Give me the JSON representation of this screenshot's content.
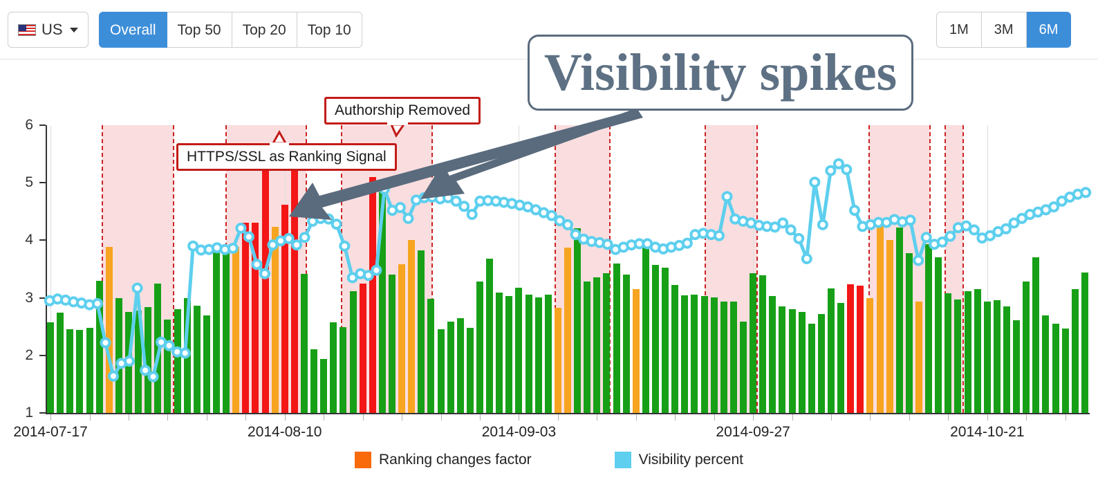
{
  "toolbar": {
    "country": {
      "label": "US",
      "flag_icon": "us-flag-icon",
      "caret_icon": "chevron-down-icon"
    },
    "views": [
      {
        "label": "Overall",
        "active": true
      },
      {
        "label": "Top 50",
        "active": false
      },
      {
        "label": "Top 20",
        "active": false
      },
      {
        "label": "Top 10",
        "active": false
      }
    ],
    "ranges": [
      {
        "label": "1M",
        "active": false
      },
      {
        "label": "3M",
        "active": false
      },
      {
        "label": "6M",
        "active": true
      }
    ]
  },
  "annotations": {
    "authorship": "Authorship Removed",
    "https": "HTTPS/SSL as Ranking Signal",
    "spikes": "Visibility spikes"
  },
  "legend": [
    {
      "label": "Ranking changes factor",
      "color": "#f96a0b"
    },
    {
      "label": "Visibility percent",
      "color": "#5ecfee"
    }
  ],
  "colors": {
    "bar_normal": "#17a017",
    "bar_warn": "#f7a420",
    "bar_alert": "#f21616",
    "line": "#5ecfee",
    "marker_fill": "#ffffff",
    "band": "#fadedf",
    "band_edge": "#cc2222",
    "accent_blue": "#3d8ed8",
    "callout_border": "#c21b17",
    "spike_text": "#5e7184"
  },
  "chart_data": {
    "type": "bar",
    "title": "",
    "xlabel": "",
    "ylabel": "",
    "ylim": [
      1,
      6
    ],
    "yticks": [
      1,
      2,
      3,
      4,
      5,
      6
    ],
    "grid": true,
    "legend_position": "bottom",
    "xtick_labels": [
      "2014-07-17",
      "2014-08-10",
      "2014-09-03",
      "2014-09-27",
      "2014-10-21"
    ],
    "xtick_index": [
      0,
      24,
      48,
      72,
      96
    ],
    "series": [
      {
        "name": "Ranking changes factor",
        "type": "bar",
        "values": [
          2.57,
          2.74,
          2.46,
          2.44,
          2.48,
          3.3,
          3.88,
          2.99,
          2.76,
          2.78,
          2.84,
          3.25,
          2.62,
          2.8,
          3.0,
          2.86,
          2.7,
          3.85,
          3.78,
          3.88,
          4.3,
          4.3,
          5.42,
          4.23,
          4.62,
          5.45,
          3.42,
          2.11,
          1.94,
          2.57,
          2.49,
          3.12,
          3.25,
          5.1,
          4.87,
          3.4,
          3.58,
          4.01,
          3.82,
          2.98,
          2.45,
          2.59,
          2.65,
          2.48,
          3.28,
          3.68,
          3.09,
          3.03,
          3.18,
          3.05,
          3.01,
          3.05,
          2.83,
          3.87,
          4.21,
          3.28,
          3.35,
          3.43,
          3.6,
          3.41,
          3.15,
          3.88,
          3.57,
          3.53,
          3.22,
          3.04,
          3.06,
          3.03,
          3.01,
          2.94,
          2.93,
          2.59,
          3.43,
          3.39,
          3.03,
          2.85,
          2.8,
          2.76,
          2.55,
          2.72,
          3.16,
          2.91,
          3.23,
          3.21,
          2.99,
          4.38,
          4.0,
          4.22,
          3.78,
          2.94,
          3.93,
          3.7,
          3.08,
          2.97,
          3.12,
          3.15,
          2.94,
          2.96,
          2.85,
          2.61,
          3.28,
          3.71,
          2.7,
          2.55,
          2.47,
          3.15,
          3.44
        ],
        "categories": [
          "normal",
          "normal",
          "normal",
          "normal",
          "normal",
          "normal",
          "warn",
          "normal",
          "normal",
          "normal",
          "normal",
          "normal",
          "normal",
          "normal",
          "normal",
          "normal",
          "normal",
          "normal",
          "normal",
          "warn",
          "alert",
          "alert",
          "alert",
          "warn",
          "alert",
          "alert",
          "normal",
          "normal",
          "normal",
          "normal",
          "normal",
          "normal",
          "alert",
          "alert",
          "normal",
          "normal",
          "warn",
          "warn",
          "normal",
          "normal",
          "normal",
          "normal",
          "normal",
          "normal",
          "normal",
          "normal",
          "normal",
          "normal",
          "normal",
          "normal",
          "normal",
          "normal",
          "warn",
          "warn",
          "normal",
          "normal",
          "normal",
          "normal",
          "normal",
          "normal",
          "warn",
          "normal",
          "normal",
          "normal",
          "normal",
          "normal",
          "normal",
          "normal",
          "normal",
          "normal",
          "normal",
          "normal",
          "normal",
          "normal",
          "normal",
          "normal",
          "normal",
          "normal",
          "normal",
          "normal",
          "normal",
          "normal",
          "alert",
          "alert",
          "warn",
          "warn",
          "warn",
          "normal",
          "normal",
          "warn",
          "normal",
          "normal",
          "normal",
          "normal",
          "normal",
          "normal",
          "normal",
          "normal",
          "normal",
          "normal",
          "normal",
          "normal",
          "normal",
          "normal",
          "normal",
          "normal",
          "normal",
          "normal"
        ]
      },
      {
        "name": "Visibility percent",
        "type": "line",
        "values": [
          2.95,
          2.98,
          2.96,
          2.93,
          2.91,
          2.88,
          2.9,
          2.22,
          1.64,
          1.86,
          1.9,
          3.17,
          1.74,
          1.63,
          2.23,
          2.17,
          2.06,
          2.04,
          3.9,
          3.83,
          3.84,
          3.87,
          3.84,
          3.86,
          4.21,
          4.06,
          3.58,
          3.42,
          3.92,
          3.99,
          4.03,
          3.92,
          4.05,
          4.33,
          4.38,
          4.37,
          4.28,
          3.9,
          3.35,
          3.42,
          3.39,
          3.48,
          4.89,
          4.52,
          4.57,
          4.38,
          4.7,
          4.74,
          4.75,
          4.72,
          4.74,
          4.68,
          4.59,
          4.45,
          4.68,
          4.69,
          4.68,
          4.66,
          4.64,
          4.61,
          4.58,
          4.53,
          4.48,
          4.43,
          4.34,
          4.27,
          4.1,
          4.02,
          3.98,
          3.96,
          3.93,
          3.84,
          3.88,
          3.92,
          3.94,
          3.94,
          3.88,
          3.85,
          3.88,
          3.91,
          3.95,
          4.1,
          4.12,
          4.1,
          4.08,
          4.76,
          4.37,
          4.33,
          4.3,
          4.26,
          4.24,
          4.23,
          4.3,
          4.18,
          4.03,
          3.68,
          5.01,
          4.27,
          5.21,
          5.33,
          5.23,
          4.52,
          4.24,
          4.27,
          4.31,
          4.31,
          4.36,
          4.32,
          4.35,
          3.65,
          4.05,
          3.93,
          3.97,
          4.07,
          4.22,
          4.25,
          4.18,
          4.04,
          4.08,
          4.15,
          4.2,
          4.3,
          4.38,
          4.45,
          4.49,
          4.53,
          4.58,
          4.68,
          4.75,
          4.8,
          4.83
        ]
      }
    ],
    "bands": [
      {
        "start": 5.8,
        "end": 13.1
      },
      {
        "start": 18.5,
        "end": 26.7
      },
      {
        "start": 30.3,
        "end": 39.6
      },
      {
        "start": 52.2,
        "end": 57.8
      },
      {
        "start": 67.6,
        "end": 72.9
      },
      {
        "start": 84.4,
        "end": 90.6
      },
      {
        "start": 92.2,
        "end": 94.0
      }
    ]
  }
}
